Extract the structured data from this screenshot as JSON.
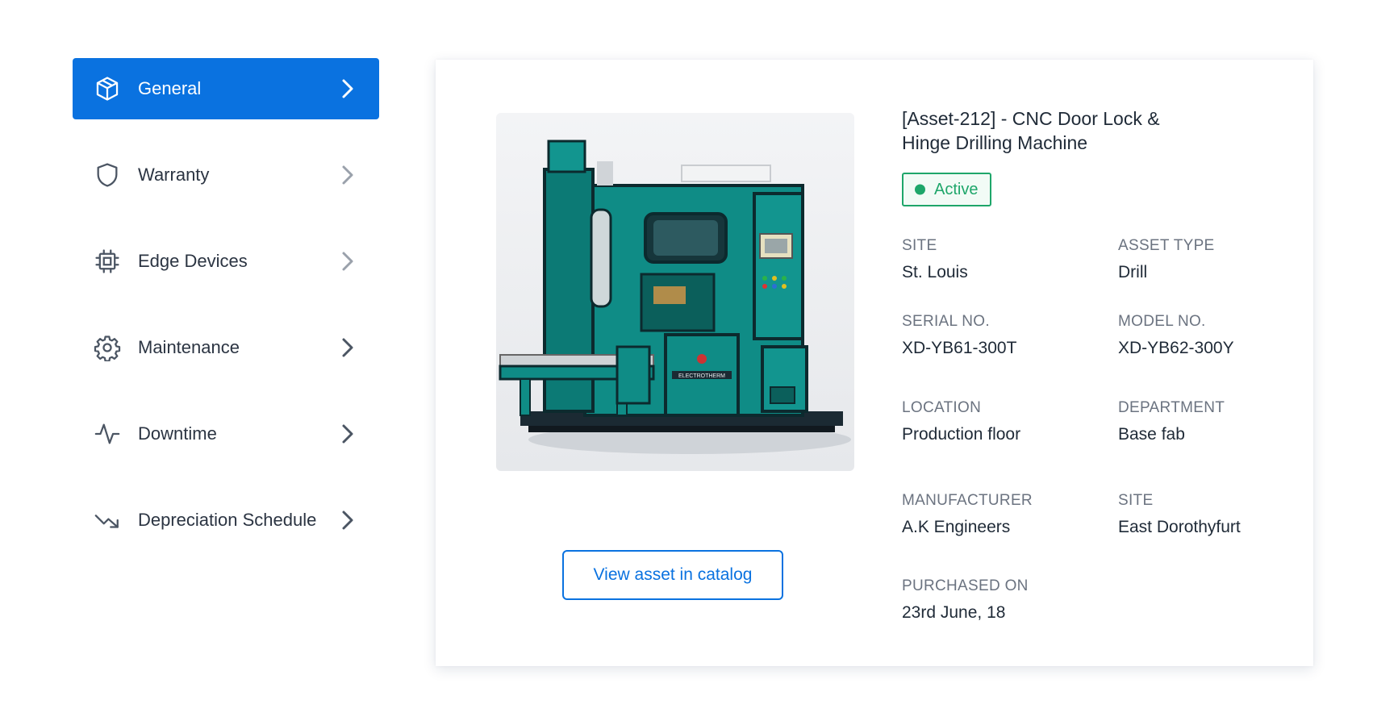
{
  "sidebar": {
    "items": [
      {
        "label": "General",
        "icon": "cube-icon",
        "active": true
      },
      {
        "label": "Warranty",
        "icon": "shield-icon",
        "active": false
      },
      {
        "label": "Edge Devices",
        "icon": "chip-icon",
        "active": false
      },
      {
        "label": "Maintenance",
        "icon": "gear-icon",
        "active": false
      },
      {
        "label": "Downtime",
        "icon": "pulse-icon",
        "active": false
      },
      {
        "label": "Depreciation Schedule",
        "icon": "trending-down-icon",
        "active": false
      }
    ]
  },
  "asset": {
    "title": "[Asset-212] - CNC Door Lock & Hinge Drilling Machine",
    "status": "Active",
    "image_label": "ELECTROTHERM",
    "catalog_button": "View asset in catalog",
    "fields": [
      {
        "label": "SITE",
        "value": "St. Louis"
      },
      {
        "label": "ASSET TYPE",
        "value": "Drill"
      },
      {
        "label": "SERIAL NO.",
        "value": "XD-YB61-300T"
      },
      {
        "label": "MODEL NO.",
        "value": "XD-YB62-300Y"
      },
      {
        "label": "LOCATION",
        "value": "Production floor"
      },
      {
        "label": "DEPARTMENT",
        "value": "Base fab"
      },
      {
        "label": "MANUFACTURER",
        "value": "A.K Engineers"
      },
      {
        "label": "SITE",
        "value": "East Dorothyfurt"
      },
      {
        "label": "PURCHASED ON",
        "value": "23rd June, 18"
      }
    ]
  },
  "colors": {
    "accent": "#0a72e0",
    "active_status": "#1ea66a",
    "machine_teal": "#0f8c86"
  }
}
